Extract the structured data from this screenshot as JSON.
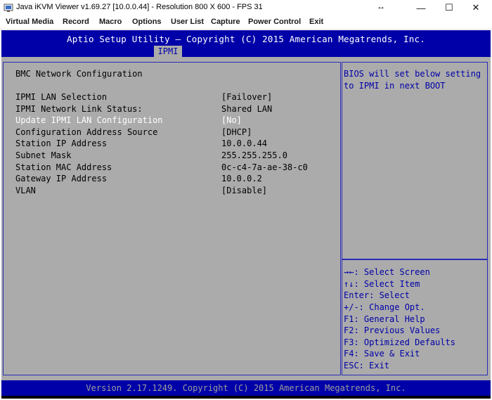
{
  "window": {
    "title": "Java iKVM Viewer v1.69.27 [10.0.0.44]  - Resolution 800 X 600 - FPS 31",
    "resize_glyph": "↔",
    "min_glyph": "—",
    "max_glyph": "☐",
    "close_glyph": "✕"
  },
  "menu": [
    "Virtual Media",
    "Record",
    "Macro",
    "Options",
    "User List",
    "Capture",
    "Power Control",
    "Exit"
  ],
  "bios": {
    "title": "Aptio Setup Utility – Copyright (C) 2015 American Megatrends, Inc.",
    "tab": "IPMI",
    "section_title": "BMC Network Configuration",
    "rows": [
      {
        "label": "IPMI LAN Selection",
        "value": "[Failover]"
      },
      {
        "label": "IPMI Network Link Status:",
        "value": "Shared LAN"
      },
      {
        "label": "Update IPMI LAN Configuration",
        "value": "[No]"
      },
      {
        "label": "Configuration Address Source",
        "value": "[DHCP]"
      },
      {
        "label": "Station IP Address",
        "value": "10.0.0.44"
      },
      {
        "label": "Subnet Mask",
        "value": "255.255.255.0"
      },
      {
        "label": "Station MAC Address",
        "value": "0c-c4-7a-ae-38-c0"
      },
      {
        "label": "Gateway IP Address",
        "value": "10.0.0.2"
      },
      {
        "label": "VLAN",
        "value": "[Disable]"
      }
    ],
    "help_lines": [
      "BIOS will set below setting",
      "to IPMI in next BOOT"
    ],
    "key_help": [
      "→←: Select Screen",
      "↑↓: Select Item",
      "Enter: Select",
      "+/-: Change Opt.",
      "F1: General Help",
      "F2: Previous Values",
      "F3: Optimized Defaults",
      "F4: Save & Exit",
      "ESC: Exit"
    ],
    "footer": "Version 2.17.1249. Copyright (C) 2015 American Megatrends, Inc."
  },
  "colors": {
    "bios_blue": "#0000a8",
    "bios_gray": "#ababab",
    "selected_text": "#ffffff"
  }
}
